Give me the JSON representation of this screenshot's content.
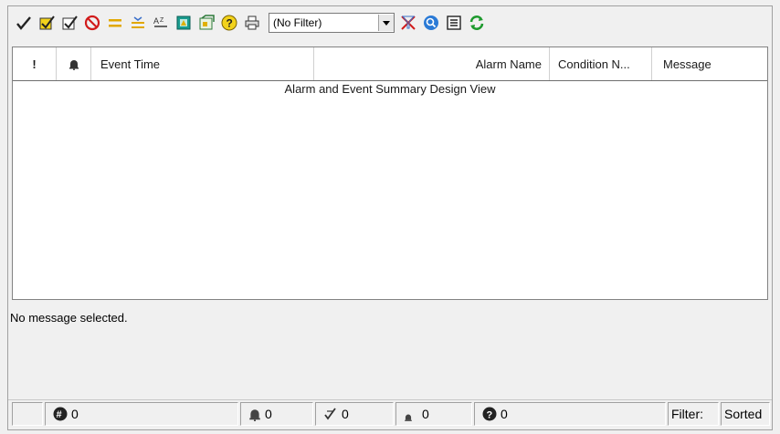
{
  "toolbar": {
    "buttons": [
      "ack-check-icon",
      "ack-selected-icon",
      "ack-visible-icon",
      "shelve-icon",
      "equal-sort-icon",
      "sort-lines-icon",
      "sort-alpha-icon",
      "view-icon",
      "query-icon",
      "help-icon",
      "print-icon"
    ],
    "filter": {
      "value": "(No Filter)"
    },
    "buttons_after": [
      "clear-filter-icon",
      "find-icon",
      "list-icon",
      "refresh-icon"
    ]
  },
  "grid": {
    "columns": [
      "!",
      "Event Time",
      "Alarm Name",
      "Condition N...",
      "Message"
    ],
    "placeholder": "Alarm and Event Summary Design View"
  },
  "details": {
    "text": "No message selected."
  },
  "status": {
    "total": "0",
    "alarms": "0",
    "unacked": "0",
    "priority": "0",
    "unknown": "0",
    "filter_label": "Filter:",
    "sorted_label": "Sorted"
  },
  "colors": {
    "accent_yellow": "#f2d21b",
    "refresh_green": "#1e9a2e",
    "find_blue": "#2a7ad6",
    "stop_red": "#d11b1b"
  }
}
